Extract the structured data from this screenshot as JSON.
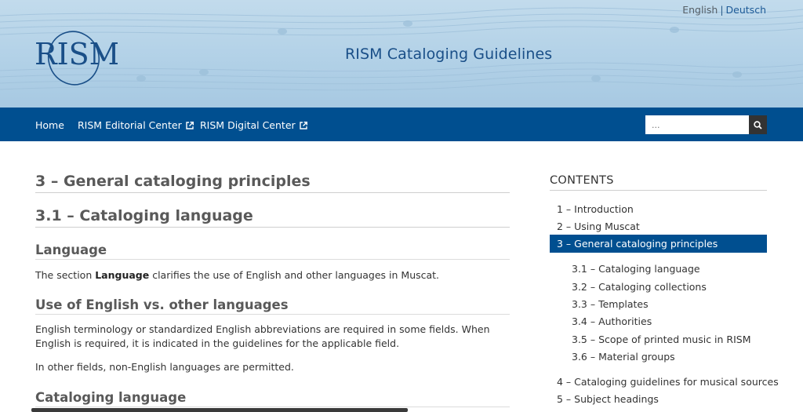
{
  "header": {
    "lang_current": "English",
    "lang_separator": "|",
    "lang_other": "Deutsch",
    "logo_text": "RISM",
    "site_title": "RISM Cataloging Guidelines"
  },
  "nav": {
    "items": [
      {
        "label": "Home",
        "external": false
      },
      {
        "label": "RISM Editorial Center",
        "external": true
      },
      {
        "label": "RISM Digital Center",
        "external": true
      }
    ],
    "search_placeholder": "...",
    "search_icon": "search-icon",
    "external_icon": "external-link-icon"
  },
  "content": {
    "h1": "3 – General cataloging principles",
    "h2": "3.1 – Cataloging language",
    "section_language": "Language",
    "p_language_pre": "The section ",
    "p_language_bold": "Language",
    "p_language_post": " clarifies the use of English and other languages in Muscat.",
    "section_use": "Use of English vs. other languages",
    "p_use_1": "English terminology or standardized English abbreviations are required in some fields. When English is required, it is indicated in the guidelines for the applicable field.",
    "p_use_2": "In other fields, non-English languages are permitted.",
    "section_cataloging": "Cataloging language"
  },
  "sidebar": {
    "title": "CONTENTS",
    "items": [
      "1 – Introduction",
      "2 – Using Muscat",
      "3 – General cataloging principles",
      "3.1 – Cataloging language",
      "3.2 – Cataloging collections",
      "3.3 – Templates",
      "3.4 – Authorities",
      "3.5 – Scope of printed music in RISM",
      "3.6 – Material groups",
      "4 – Cataloging guidelines for musical sources",
      "5 – Subject headings"
    ]
  },
  "colors": {
    "nav_bg": "#004f90",
    "title_blue": "#1a4f88",
    "banner_bg": "#b2d1e7"
  }
}
